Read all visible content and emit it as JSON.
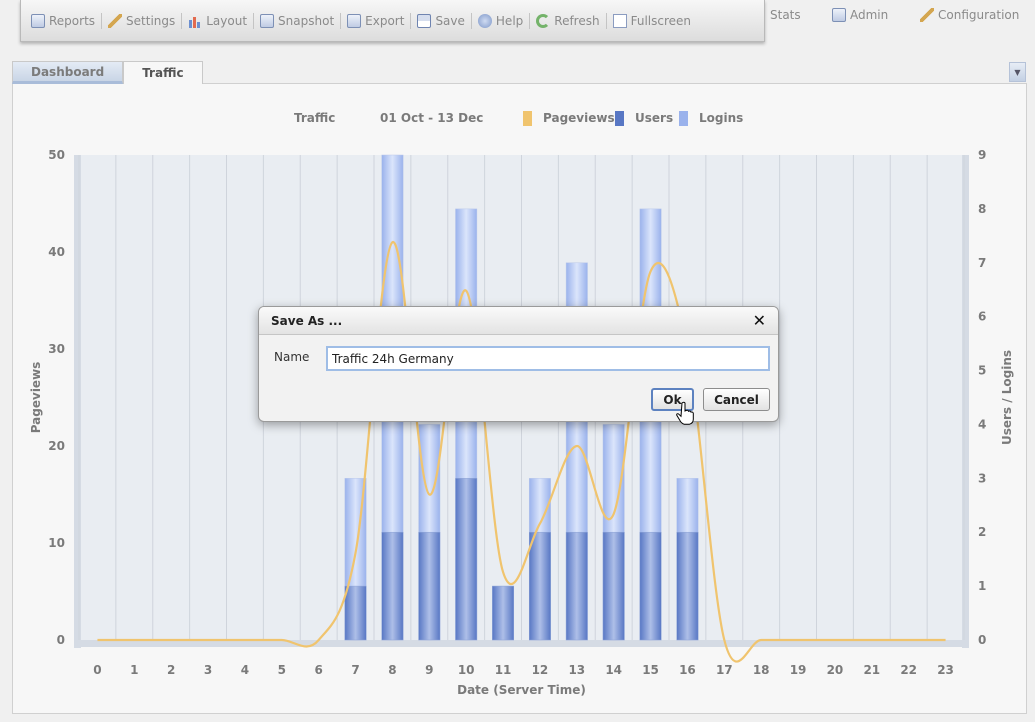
{
  "toolbar": {
    "items": [
      {
        "label": "Reports",
        "icon": "reports-icon"
      },
      {
        "label": "Settings",
        "icon": "wrench-icon"
      },
      {
        "label": "Layout",
        "icon": "bar-chart-icon"
      },
      {
        "label": "Snapshot",
        "icon": "camera-icon"
      },
      {
        "label": "Export",
        "icon": "export-icon"
      },
      {
        "label": "Save",
        "icon": "disk-icon"
      },
      {
        "label": "Help",
        "icon": "help-icon"
      },
      {
        "label": "Refresh",
        "icon": "refresh-icon"
      },
      {
        "label": "Fullscreen",
        "icon": "fullscreen-icon"
      }
    ]
  },
  "topnav": {
    "stats": "Stats",
    "admin": "Admin",
    "configuration": "Configuration"
  },
  "tabs": {
    "dashboard": "Dashboard",
    "traffic": "Traffic",
    "active": "Traffic"
  },
  "dialog": {
    "title": "Save As ...",
    "close_symbol": "✕",
    "name_label": "Name",
    "name_value": "Traffic 24h Germany",
    "ok_label": "Ok",
    "cancel_label": "Cancel"
  },
  "chart_data": {
    "type": "bar",
    "title": "Traffic",
    "subtitle": "01 Oct - 13 Dec",
    "xlabel": "Date (Server Time)",
    "ylabel": "Pageviews",
    "ylabel_right": "Users / Logins",
    "legend": [
      "Pageviews",
      "Users",
      "Logins"
    ],
    "legend_position": "top",
    "colors": {
      "pageviews": "#f0c46e",
      "users": "#5877c4",
      "logins": "#9ab2ec"
    },
    "grid": true,
    "categories": [
      0,
      1,
      2,
      3,
      4,
      5,
      6,
      7,
      8,
      9,
      10,
      11,
      12,
      13,
      14,
      15,
      16,
      17,
      18,
      19,
      20,
      21,
      22,
      23
    ],
    "ylim": [
      0,
      50
    ],
    "ylim_right": [
      0,
      9
    ],
    "yticks": [
      0,
      10,
      20,
      30,
      40,
      50
    ],
    "yticks_right": [
      0,
      1,
      2,
      3,
      4,
      5,
      6,
      7,
      8,
      9
    ],
    "series": [
      {
        "name": "Pageviews",
        "axis": "left",
        "style": "line",
        "values": [
          0,
          0,
          0,
          0,
          0,
          0,
          0,
          9,
          41,
          15,
          36,
          7,
          12,
          20,
          13,
          38,
          30,
          0,
          0,
          0,
          0,
          0,
          0,
          0
        ]
      },
      {
        "name": "Users",
        "axis": "right",
        "style": "bar",
        "values": [
          0,
          0,
          0,
          0,
          0,
          0,
          0,
          1,
          2,
          2,
          3,
          1,
          2,
          2,
          2,
          2,
          2,
          0,
          0,
          0,
          0,
          0,
          0,
          0
        ]
      },
      {
        "name": "Logins",
        "axis": "right",
        "style": "bar",
        "values": [
          0,
          0,
          0,
          0,
          0,
          0,
          0,
          3,
          9,
          4,
          8,
          1,
          3,
          7,
          4,
          8,
          3,
          0,
          0,
          0,
          0,
          0,
          0,
          0
        ]
      }
    ]
  }
}
